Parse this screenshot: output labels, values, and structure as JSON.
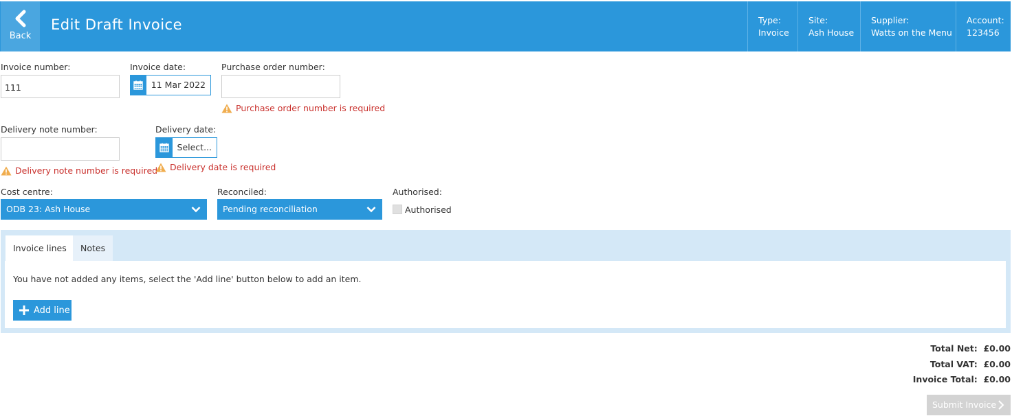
{
  "header": {
    "back_label": "Back",
    "title": "Edit Draft Invoice",
    "meta": [
      {
        "label": "Type:",
        "value": "Invoice"
      },
      {
        "label": "Site:",
        "value": "Ash House"
      },
      {
        "label": "Supplier:",
        "value": "Watts on the Menu"
      },
      {
        "label": "Account:",
        "value": "123456"
      }
    ]
  },
  "form": {
    "invoice_number": {
      "label": "Invoice number:",
      "value": "111"
    },
    "invoice_date": {
      "label": "Invoice date:",
      "value": "11 Mar 2022"
    },
    "po_number": {
      "label": "Purchase order number:",
      "value": "",
      "error": "Purchase order number is required"
    },
    "delivery_note": {
      "label": "Delivery note number:",
      "value": "",
      "error": "Delivery note number is required"
    },
    "delivery_date": {
      "label": "Delivery date:",
      "value": "Select...",
      "error": "Delivery date is required"
    },
    "cost_centre": {
      "label": "Cost centre:",
      "value": "ODB 23: Ash House"
    },
    "reconciled": {
      "label": "Reconciled:",
      "value": "Pending reconciliation"
    },
    "authorised": {
      "label": "Authorised:",
      "checkbox_label": "Authorised",
      "checked": false
    }
  },
  "tabs": [
    {
      "label": "Invoice lines",
      "active": true
    },
    {
      "label": "Notes",
      "active": false
    }
  ],
  "lines": {
    "empty_message": "You have not added any items, select the 'Add line' button below to add an item.",
    "add_label": "Add line"
  },
  "totals": {
    "net_label": "Total Net:",
    "net_value": "£0.00",
    "vat_label": "Total VAT:",
    "vat_value": "£0.00",
    "total_label": "Invoice Total:",
    "total_value": "£0.00"
  },
  "submit_label": "Submit Invoice",
  "colors": {
    "accent": "#2b97db",
    "error": "#c9302c",
    "warning_icon": "#f0ad4e",
    "panel": "#d4e8f7"
  }
}
